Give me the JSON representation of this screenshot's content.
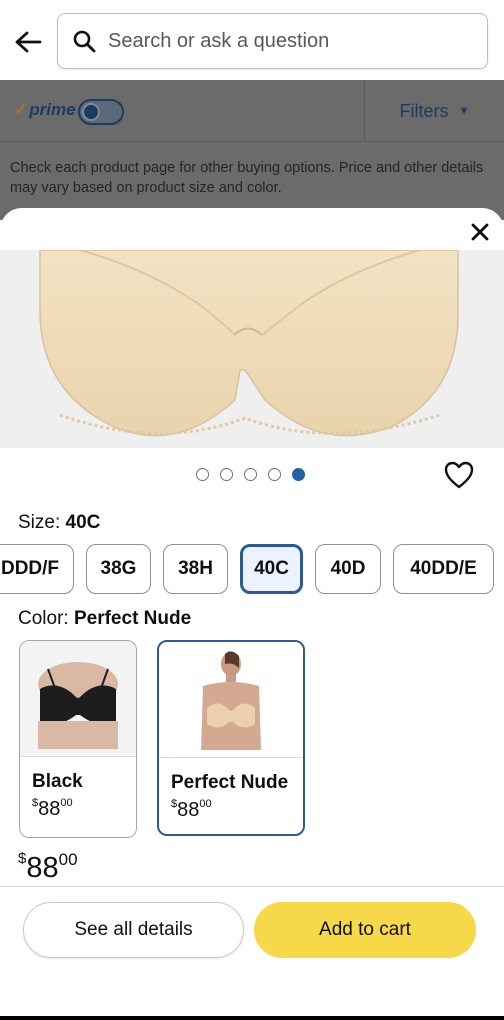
{
  "search": {
    "placeholder": "Search or ask a question"
  },
  "filter_bar": {
    "prime_label": "prime",
    "filters_label": "Filters"
  },
  "notice": "Check each product page for other buying options. Price and other details may vary based on product size and color.",
  "carousel": {
    "total": 5,
    "active_index": 4
  },
  "size": {
    "label": "Size:",
    "selected": "40C",
    "options": [
      "DDD/F",
      "38G",
      "38H",
      "40C",
      "40D",
      "40DD/E"
    ]
  },
  "color": {
    "label": "Color:",
    "selected": "Perfect Nude",
    "options": [
      {
        "name": "Black",
        "currency": "$",
        "dollars": "88",
        "cents": "00"
      },
      {
        "name": "Perfect Nude",
        "currency": "$",
        "dollars": "88",
        "cents": "00"
      }
    ]
  },
  "price": {
    "currency": "$",
    "dollars": "88",
    "cents": "00"
  },
  "buttons": {
    "see_details": "See all details",
    "add_to_cart": "Add to cart"
  },
  "colors": {
    "accent_blue": "#2f5a8f",
    "cart_yellow": "#f7d848",
    "overlay": "#6b6b6b"
  }
}
